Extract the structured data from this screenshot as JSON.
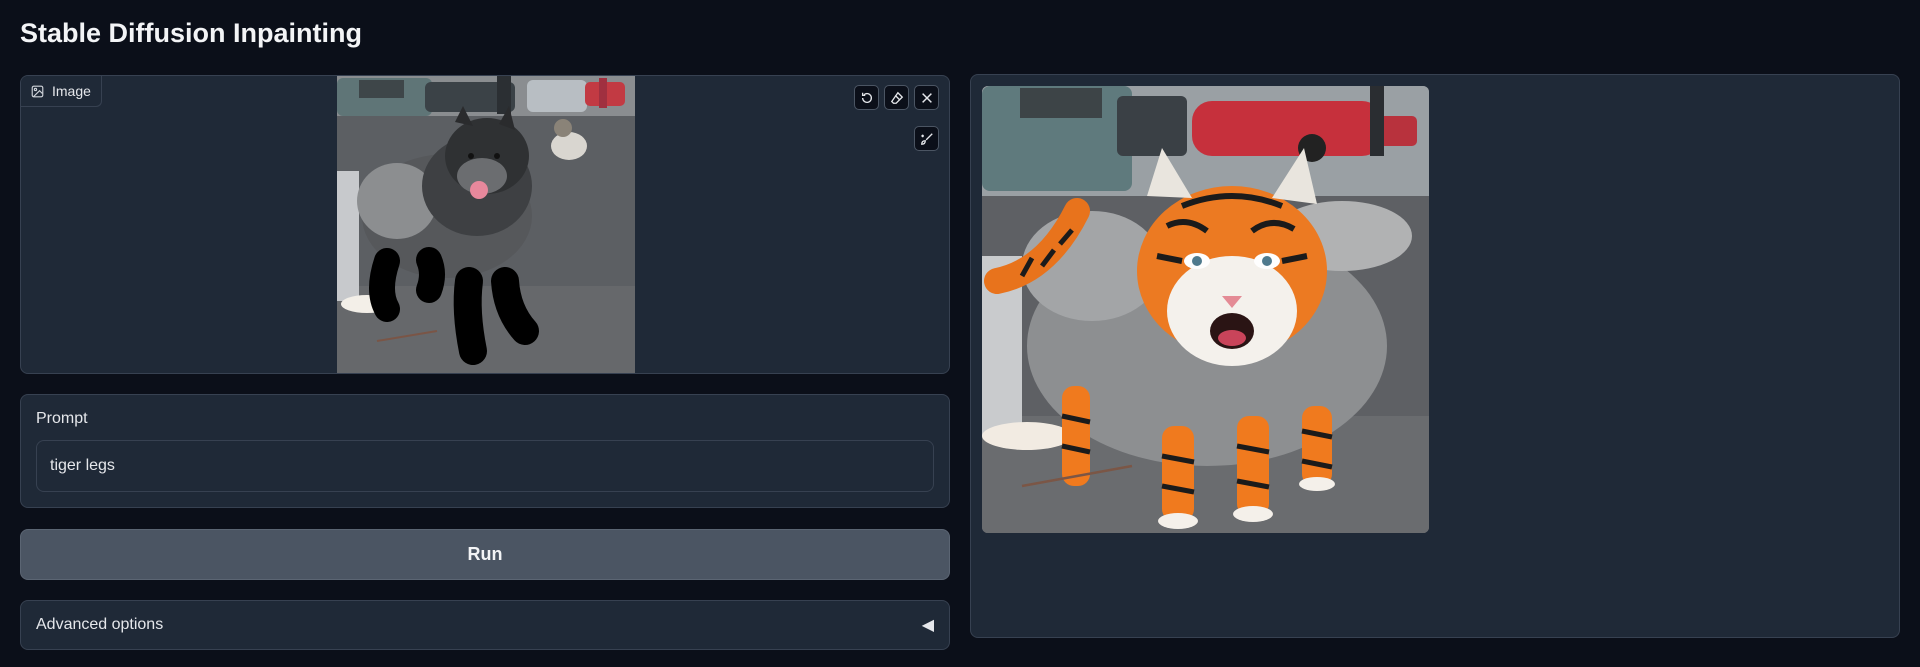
{
  "page": {
    "title": "Stable Diffusion Inpainting"
  },
  "image_input": {
    "label": "Image",
    "icon": "image-icon",
    "toolbar": [
      "undo-icon",
      "eraser-icon",
      "close-icon",
      "brush-icon"
    ],
    "scene": "dog standing on wet pavement with black mask strokes over its legs"
  },
  "prompt": {
    "label": "Prompt",
    "value": "tiger legs"
  },
  "run": {
    "label": "Run"
  },
  "advanced": {
    "label": "Advanced options",
    "caret": "◀"
  },
  "output": {
    "scene": "generated creature with tiger head and orange tiger-striped legs"
  },
  "colors": {
    "background": "#0b0f19",
    "panel": "#1f2937",
    "border": "#374151",
    "button": "#4b5563",
    "text": "#e5e7eb"
  }
}
